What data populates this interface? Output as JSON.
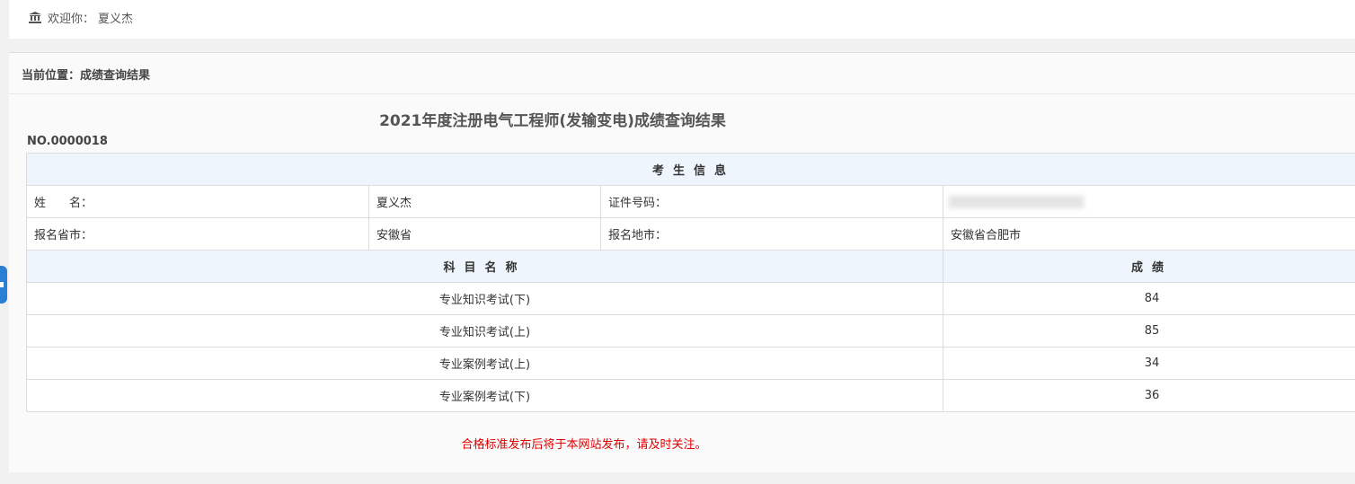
{
  "header": {
    "welcome_label": "欢迎你：",
    "user_name": "夏义杰"
  },
  "breadcrumb": "当前位置：成绩查询结果",
  "page_title": "2021年度注册电气工程师(发输变电)成绩查询结果",
  "cert_no": "NO.0000018",
  "candidate_info": {
    "section_title": "考生信息",
    "name_label": "姓　　名：",
    "name_value": "夏义杰",
    "id_label": "证件号码：",
    "id_value": "",
    "province_label": "报名省市：",
    "province_value": "安徽省",
    "city_label": "报名地市：",
    "city_value": "安徽省合肥市"
  },
  "scores": {
    "subject_header": "科目名称",
    "score_header": "成绩",
    "rows": [
      {
        "subject": "专业知识考试(下)",
        "score": "84"
      },
      {
        "subject": "专业知识考试(上)",
        "score": "85"
      },
      {
        "subject": "专业案例考试(上)",
        "score": "34"
      },
      {
        "subject": "专业案例考试(下)",
        "score": "36"
      }
    ]
  },
  "notice": "合格标准发布后将于本网站发布，请及时关注。",
  "icons": {
    "welcome": "bank-icon",
    "side_tab": "side-toggle-icon"
  },
  "colors": {
    "table_header_bg": "#eef5fc",
    "notice": "#e00000",
    "side_tab": "#2a7fd4"
  }
}
